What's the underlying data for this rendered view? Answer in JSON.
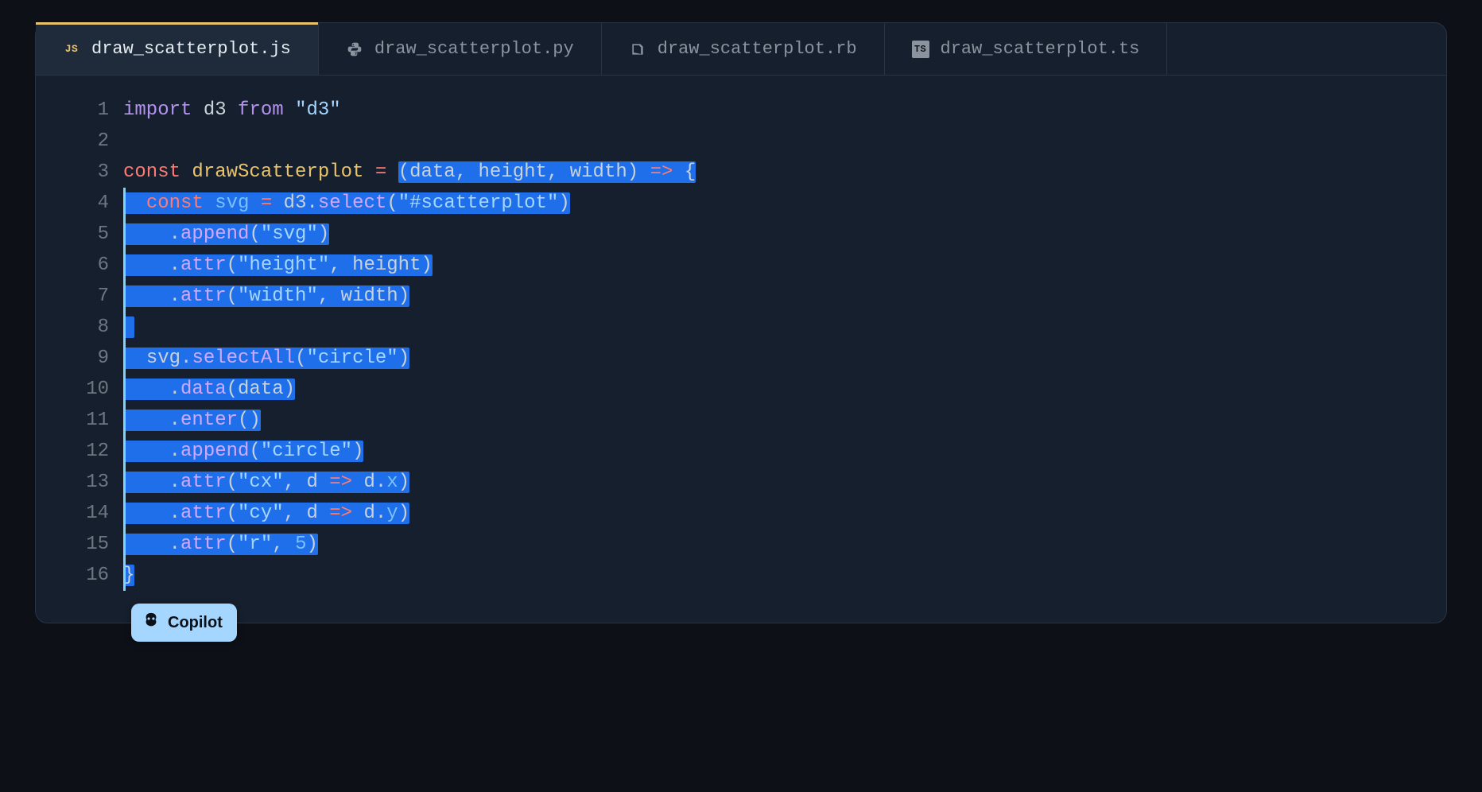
{
  "tabs": [
    {
      "label": "draw_scatterplot.js",
      "icon": "JS",
      "active": true,
      "lang": "js"
    },
    {
      "label": "draw_scatterplot.py",
      "icon": "PY",
      "active": false,
      "lang": "py"
    },
    {
      "label": "draw_scatterplot.rb",
      "icon": "RB",
      "active": false,
      "lang": "rb"
    },
    {
      "label": "draw_scatterplot.ts",
      "icon": "TS",
      "active": false,
      "lang": "ts"
    }
  ],
  "copilot_label": "Copilot",
  "code": {
    "lines": [
      {
        "n": 1,
        "guide": false,
        "segs": [
          {
            "t": "import",
            "c": "tok-kw-purple"
          },
          {
            "t": " ",
            "c": "tok-plain"
          },
          {
            "t": "d3",
            "c": "tok-plain"
          },
          {
            "t": " ",
            "c": "tok-plain"
          },
          {
            "t": "from",
            "c": "tok-kw-purple"
          },
          {
            "t": " ",
            "c": "tok-plain"
          },
          {
            "t": "\"d3\"",
            "c": "tok-str"
          }
        ]
      },
      {
        "n": 2,
        "guide": false,
        "segs": []
      },
      {
        "n": 3,
        "guide": false,
        "segs": [
          {
            "t": "const",
            "c": "tok-kw-red"
          },
          {
            "t": " ",
            "c": "tok-plain"
          },
          {
            "t": "drawScatterplot",
            "c": "tok-id-yellow"
          },
          {
            "t": " ",
            "c": "tok-plain"
          },
          {
            "t": "=",
            "c": "tok-kw-red"
          },
          {
            "t": " ",
            "c": "tok-plain"
          },
          {
            "t": "(",
            "c": "tok-punc",
            "sel": true
          },
          {
            "t": "data",
            "c": "tok-plain",
            "sel": true
          },
          {
            "t": ", ",
            "c": "tok-punc",
            "sel": true
          },
          {
            "t": "height",
            "c": "tok-plain",
            "sel": true
          },
          {
            "t": ", ",
            "c": "tok-punc",
            "sel": true
          },
          {
            "t": "width",
            "c": "tok-plain",
            "sel": true
          },
          {
            "t": ")",
            "c": "tok-punc",
            "sel": true
          },
          {
            "t": " ",
            "c": "tok-plain",
            "sel": true
          },
          {
            "t": "=>",
            "c": "tok-kw-red",
            "sel": true
          },
          {
            "t": " ",
            "c": "tok-plain",
            "sel": true
          },
          {
            "t": "{",
            "c": "tok-punc",
            "sel": true
          }
        ]
      },
      {
        "n": 4,
        "guide": true,
        "segs": [
          {
            "t": "  ",
            "c": "tok-plain",
            "sel": true
          },
          {
            "t": "const",
            "c": "tok-kw-red",
            "sel": true
          },
          {
            "t": " ",
            "c": "tok-plain",
            "sel": true
          },
          {
            "t": "svg",
            "c": "tok-var-cyan",
            "sel": true
          },
          {
            "t": " ",
            "c": "tok-plain",
            "sel": true
          },
          {
            "t": "=",
            "c": "tok-kw-red",
            "sel": true
          },
          {
            "t": " ",
            "c": "tok-plain",
            "sel": true
          },
          {
            "t": "d3",
            "c": "tok-plain",
            "sel": true
          },
          {
            "t": ".",
            "c": "tok-punc",
            "sel": true
          },
          {
            "t": "select",
            "c": "tok-fn",
            "sel": true
          },
          {
            "t": "(",
            "c": "tok-punc",
            "sel": true
          },
          {
            "t": "\"#scatterplot\"",
            "c": "tok-str",
            "sel": true
          },
          {
            "t": ")",
            "c": "tok-punc",
            "sel": true
          }
        ]
      },
      {
        "n": 5,
        "guide": true,
        "segs": [
          {
            "t": "    ",
            "c": "tok-plain",
            "sel": true
          },
          {
            "t": ".",
            "c": "tok-punc",
            "sel": true
          },
          {
            "t": "append",
            "c": "tok-fn",
            "sel": true
          },
          {
            "t": "(",
            "c": "tok-punc",
            "sel": true
          },
          {
            "t": "\"svg\"",
            "c": "tok-str",
            "sel": true
          },
          {
            "t": ")",
            "c": "tok-punc",
            "sel": true
          }
        ]
      },
      {
        "n": 6,
        "guide": true,
        "segs": [
          {
            "t": "    ",
            "c": "tok-plain",
            "sel": true
          },
          {
            "t": ".",
            "c": "tok-punc",
            "sel": true
          },
          {
            "t": "attr",
            "c": "tok-fn",
            "sel": true
          },
          {
            "t": "(",
            "c": "tok-punc",
            "sel": true
          },
          {
            "t": "\"height\"",
            "c": "tok-str",
            "sel": true
          },
          {
            "t": ", ",
            "c": "tok-punc",
            "sel": true
          },
          {
            "t": "height",
            "c": "tok-plain",
            "sel": true
          },
          {
            "t": ")",
            "c": "tok-punc",
            "sel": true
          }
        ]
      },
      {
        "n": 7,
        "guide": true,
        "segs": [
          {
            "t": "    ",
            "c": "tok-plain",
            "sel": true
          },
          {
            "t": ".",
            "c": "tok-punc",
            "sel": true
          },
          {
            "t": "attr",
            "c": "tok-fn",
            "sel": true
          },
          {
            "t": "(",
            "c": "tok-punc",
            "sel": true
          },
          {
            "t": "\"width\"",
            "c": "tok-str",
            "sel": true
          },
          {
            "t": ", ",
            "c": "tok-punc",
            "sel": true
          },
          {
            "t": "width",
            "c": "tok-plain",
            "sel": true
          },
          {
            "t": ")",
            "c": "tok-punc",
            "sel": true
          }
        ]
      },
      {
        "n": 8,
        "guide": true,
        "segs": [
          {
            "t": " ",
            "c": "tok-plain",
            "sel": true
          }
        ]
      },
      {
        "n": 9,
        "guide": true,
        "segs": [
          {
            "t": "  ",
            "c": "tok-plain",
            "sel": true
          },
          {
            "t": "svg",
            "c": "tok-plain",
            "sel": true
          },
          {
            "t": ".",
            "c": "tok-punc",
            "sel": true
          },
          {
            "t": "selectAll",
            "c": "tok-fn",
            "sel": true
          },
          {
            "t": "(",
            "c": "tok-punc",
            "sel": true
          },
          {
            "t": "\"circle\"",
            "c": "tok-str",
            "sel": true
          },
          {
            "t": ")",
            "c": "tok-punc",
            "sel": true
          }
        ]
      },
      {
        "n": 10,
        "guide": true,
        "segs": [
          {
            "t": "    ",
            "c": "tok-plain",
            "sel": true
          },
          {
            "t": ".",
            "c": "tok-punc",
            "sel": true
          },
          {
            "t": "data",
            "c": "tok-fn",
            "sel": true
          },
          {
            "t": "(",
            "c": "tok-punc",
            "sel": true
          },
          {
            "t": "data",
            "c": "tok-plain",
            "sel": true
          },
          {
            "t": ")",
            "c": "tok-punc",
            "sel": true
          }
        ]
      },
      {
        "n": 11,
        "guide": true,
        "segs": [
          {
            "t": "    ",
            "c": "tok-plain",
            "sel": true
          },
          {
            "t": ".",
            "c": "tok-punc",
            "sel": true
          },
          {
            "t": "enter",
            "c": "tok-fn",
            "sel": true
          },
          {
            "t": "()",
            "c": "tok-punc",
            "sel": true
          }
        ]
      },
      {
        "n": 12,
        "guide": true,
        "segs": [
          {
            "t": "    ",
            "c": "tok-plain",
            "sel": true
          },
          {
            "t": ".",
            "c": "tok-punc",
            "sel": true
          },
          {
            "t": "append",
            "c": "tok-fn",
            "sel": true
          },
          {
            "t": "(",
            "c": "tok-punc",
            "sel": true
          },
          {
            "t": "\"circle\"",
            "c": "tok-str",
            "sel": true
          },
          {
            "t": ")",
            "c": "tok-punc",
            "sel": true
          }
        ]
      },
      {
        "n": 13,
        "guide": true,
        "segs": [
          {
            "t": "    ",
            "c": "tok-plain",
            "sel": true
          },
          {
            "t": ".",
            "c": "tok-punc",
            "sel": true
          },
          {
            "t": "attr",
            "c": "tok-fn",
            "sel": true
          },
          {
            "t": "(",
            "c": "tok-punc",
            "sel": true
          },
          {
            "t": "\"cx\"",
            "c": "tok-str",
            "sel": true
          },
          {
            "t": ", ",
            "c": "tok-punc",
            "sel": true
          },
          {
            "t": "d",
            "c": "tok-plain",
            "sel": true
          },
          {
            "t": " ",
            "c": "tok-plain",
            "sel": true
          },
          {
            "t": "=>",
            "c": "tok-kw-red",
            "sel": true
          },
          {
            "t": " ",
            "c": "tok-plain",
            "sel": true
          },
          {
            "t": "d",
            "c": "tok-plain",
            "sel": true
          },
          {
            "t": ".",
            "c": "tok-punc",
            "sel": true
          },
          {
            "t": "x",
            "c": "tok-prop",
            "sel": true
          },
          {
            "t": ")",
            "c": "tok-punc",
            "sel": true
          }
        ]
      },
      {
        "n": 14,
        "guide": true,
        "segs": [
          {
            "t": "    ",
            "c": "tok-plain",
            "sel": true
          },
          {
            "t": ".",
            "c": "tok-punc",
            "sel": true
          },
          {
            "t": "attr",
            "c": "tok-fn",
            "sel": true
          },
          {
            "t": "(",
            "c": "tok-punc",
            "sel": true
          },
          {
            "t": "\"cy\"",
            "c": "tok-str",
            "sel": true
          },
          {
            "t": ", ",
            "c": "tok-punc",
            "sel": true
          },
          {
            "t": "d",
            "c": "tok-plain",
            "sel": true
          },
          {
            "t": " ",
            "c": "tok-plain",
            "sel": true
          },
          {
            "t": "=>",
            "c": "tok-kw-red",
            "sel": true
          },
          {
            "t": " ",
            "c": "tok-plain",
            "sel": true
          },
          {
            "t": "d",
            "c": "tok-plain",
            "sel": true
          },
          {
            "t": ".",
            "c": "tok-punc",
            "sel": true
          },
          {
            "t": "y",
            "c": "tok-prop",
            "sel": true
          },
          {
            "t": ")",
            "c": "tok-punc",
            "sel": true
          }
        ]
      },
      {
        "n": 15,
        "guide": true,
        "segs": [
          {
            "t": "    ",
            "c": "tok-plain",
            "sel": true
          },
          {
            "t": ".",
            "c": "tok-punc",
            "sel": true
          },
          {
            "t": "attr",
            "c": "tok-fn",
            "sel": true
          },
          {
            "t": "(",
            "c": "tok-punc",
            "sel": true
          },
          {
            "t": "\"r\"",
            "c": "tok-str",
            "sel": true
          },
          {
            "t": ", ",
            "c": "tok-punc",
            "sel": true
          },
          {
            "t": "5",
            "c": "tok-num",
            "sel": true
          },
          {
            "t": ")",
            "c": "tok-punc",
            "sel": true
          }
        ]
      },
      {
        "n": 16,
        "guide": true,
        "segs": [
          {
            "t": "}",
            "c": "tok-punc",
            "sel": true
          }
        ]
      }
    ]
  }
}
